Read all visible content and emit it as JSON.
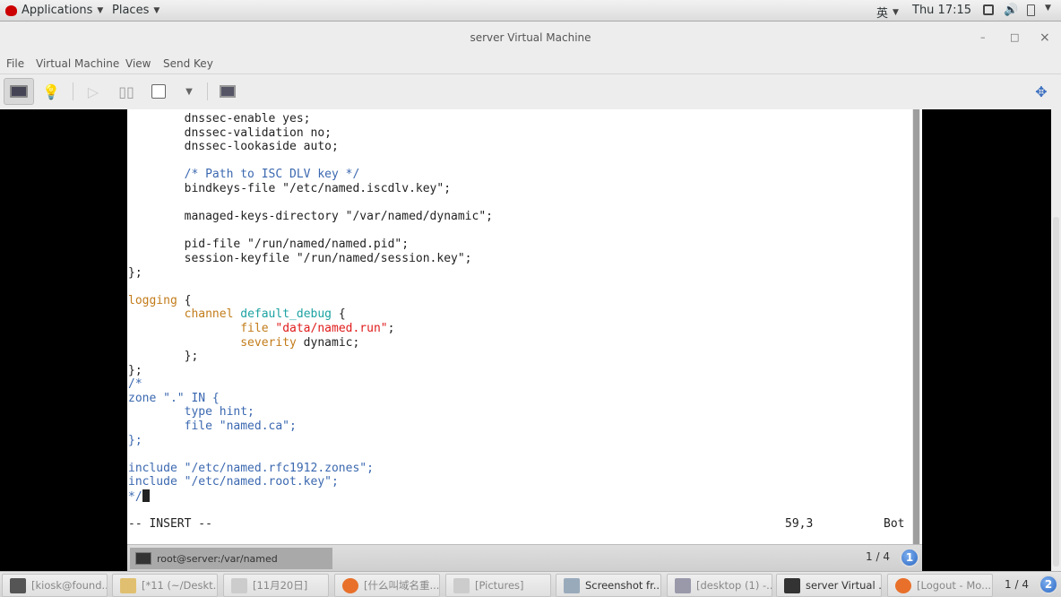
{
  "topbar": {
    "applications": "Applications",
    "places": "Places",
    "input_method": "英",
    "clock": "Thu 17:15"
  },
  "window": {
    "title": "server Virtual Machine",
    "minimize": "–",
    "maximize": "□",
    "close": "×"
  },
  "menu": {
    "file": "File",
    "virtual_machine": "Virtual Machine",
    "view": "View",
    "send_key": "Send Key"
  },
  "colors": {
    "keyword": "#c27c1a",
    "identifier": "#1ca2a2",
    "string": "#e01b1b",
    "comment": "#3b68b0",
    "text": "#222222"
  },
  "editor": {
    "lines": [
      [
        [
          "        dnssec-enable yes;",
          ""
        ]
      ],
      [
        [
          "        dnssec-validation no;",
          ""
        ]
      ],
      [
        [
          "        dnssec-lookaside auto;",
          ""
        ]
      ],
      [
        [
          "",
          ""
        ]
      ],
      [
        [
          "        /* Path to ISC DLV key */",
          "cm"
        ]
      ],
      [
        [
          "        bindkeys-file \"/etc/named.iscdlv.key\";",
          ""
        ]
      ],
      [
        [
          "",
          ""
        ]
      ],
      [
        [
          "        managed-keys-directory \"/var/named/dynamic\";",
          ""
        ]
      ],
      [
        [
          "",
          ""
        ]
      ],
      [
        [
          "        pid-file \"/run/named/named.pid\";",
          ""
        ]
      ],
      [
        [
          "        session-keyfile \"/run/named/session.key\";",
          ""
        ]
      ],
      [
        [
          "};",
          ""
        ]
      ],
      [
        [
          "",
          ""
        ]
      ],
      [
        [
          "logging",
          "kw"
        ],
        [
          " {",
          ""
        ]
      ],
      [
        [
          "        ",
          ""
        ],
        [
          "channel",
          "kw"
        ],
        [
          " ",
          ""
        ],
        [
          "default_debug",
          "id"
        ],
        [
          " {",
          ""
        ]
      ],
      [
        [
          "                ",
          ""
        ],
        [
          "file",
          "kw"
        ],
        [
          " ",
          ""
        ],
        [
          "\"data/named.run\"",
          "str"
        ],
        [
          ";",
          ""
        ]
      ],
      [
        [
          "                ",
          ""
        ],
        [
          "severity",
          "kw"
        ],
        [
          " dynamic;",
          ""
        ]
      ],
      [
        [
          "        };",
          ""
        ]
      ],
      [
        [
          "};",
          ""
        ]
      ],
      [
        [
          "/*",
          "cm"
        ]
      ],
      [
        [
          "zone \".\" IN {",
          "cm"
        ]
      ],
      [
        [
          "        type hint;",
          "cm"
        ]
      ],
      [
        [
          "        file \"named.ca\";",
          "cm"
        ]
      ],
      [
        [
          "};",
          "cm"
        ]
      ],
      [
        [
          "",
          ""
        ]
      ],
      [
        [
          "include \"/etc/named.rfc1912.zones\";",
          "cm"
        ]
      ],
      [
        [
          "include \"/etc/named.root.key\";",
          "cm"
        ]
      ],
      [
        [
          "*/",
          "cm"
        ]
      ]
    ],
    "mode": "-- INSERT --",
    "position": "59,3",
    "scroll": "Bot"
  },
  "guest_panel": {
    "task": "root@server:/var/named",
    "pager": "1 / 4",
    "workspace": "1"
  },
  "taskbar": {
    "items": [
      {
        "label": "[kiosk@found...",
        "icon": "terminal-icon"
      },
      {
        "label": "[*11 (~/Deskt...",
        "icon": "text-editor-icon"
      },
      {
        "label": "[11月20日]",
        "icon": "file-cabinet-icon"
      },
      {
        "label": "[什么叫域名重...",
        "icon": "firefox-icon"
      },
      {
        "label": "[Pictures]",
        "icon": "file-cabinet-icon"
      },
      {
        "label": "Screenshot fr...",
        "icon": "screenshot-icon",
        "active": true
      },
      {
        "label": "[desktop (1) -...",
        "icon": "monitor-icon"
      },
      {
        "label": "server Virtual ...",
        "icon": "virt-manager-icon",
        "active": true
      },
      {
        "label": "[Logout - Mo...",
        "icon": "firefox-icon"
      }
    ],
    "pager": "1 / 4",
    "workspace": "2"
  }
}
